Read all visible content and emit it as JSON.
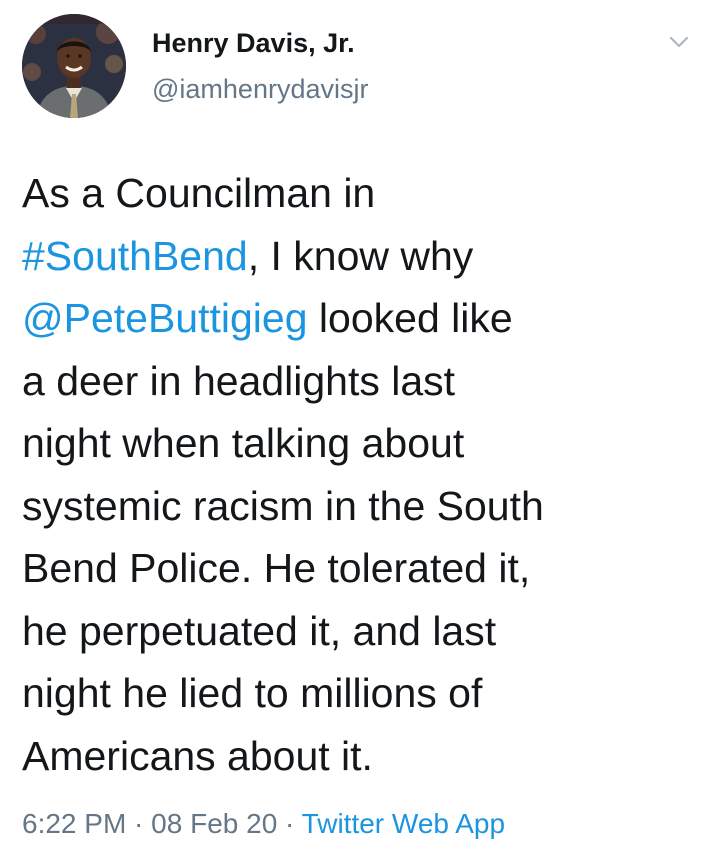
{
  "author": {
    "name": "Henry Davis, Jr.",
    "handle": "@iamhenrydavisjr"
  },
  "tweet": {
    "lines": [
      {
        "pre": "As a Councilman in",
        "link": "",
        "post": ""
      },
      {
        "pre": "",
        "link": "#SouthBend",
        "post": ", I know why"
      },
      {
        "pre": "",
        "link": "@PeteButtigieg",
        "post": " looked like"
      },
      {
        "pre": "a deer in headlights last",
        "link": "",
        "post": ""
      },
      {
        "pre": "night when talking about",
        "link": "",
        "post": ""
      },
      {
        "pre": "systemic racism in the South",
        "link": "",
        "post": ""
      },
      {
        "pre": "Bend Police. He tolerated it,",
        "link": "",
        "post": ""
      },
      {
        "pre": "he perpetuated it, and last",
        "link": "",
        "post": ""
      },
      {
        "pre": "night he lied to millions of",
        "link": "",
        "post": ""
      },
      {
        "pre": "Americans about it.",
        "link": "",
        "post": ""
      }
    ]
  },
  "meta": {
    "time": "6:22 PM",
    "separator": " · ",
    "date": "08 Feb 20",
    "separator2": " · ",
    "source": "Twitter Web App"
  },
  "colors": {
    "link": "#1b95e0",
    "secondary": "#657786",
    "text": "#14171a"
  },
  "icons": {
    "menu": "chevron-down-icon",
    "avatar": "profile-photo"
  }
}
